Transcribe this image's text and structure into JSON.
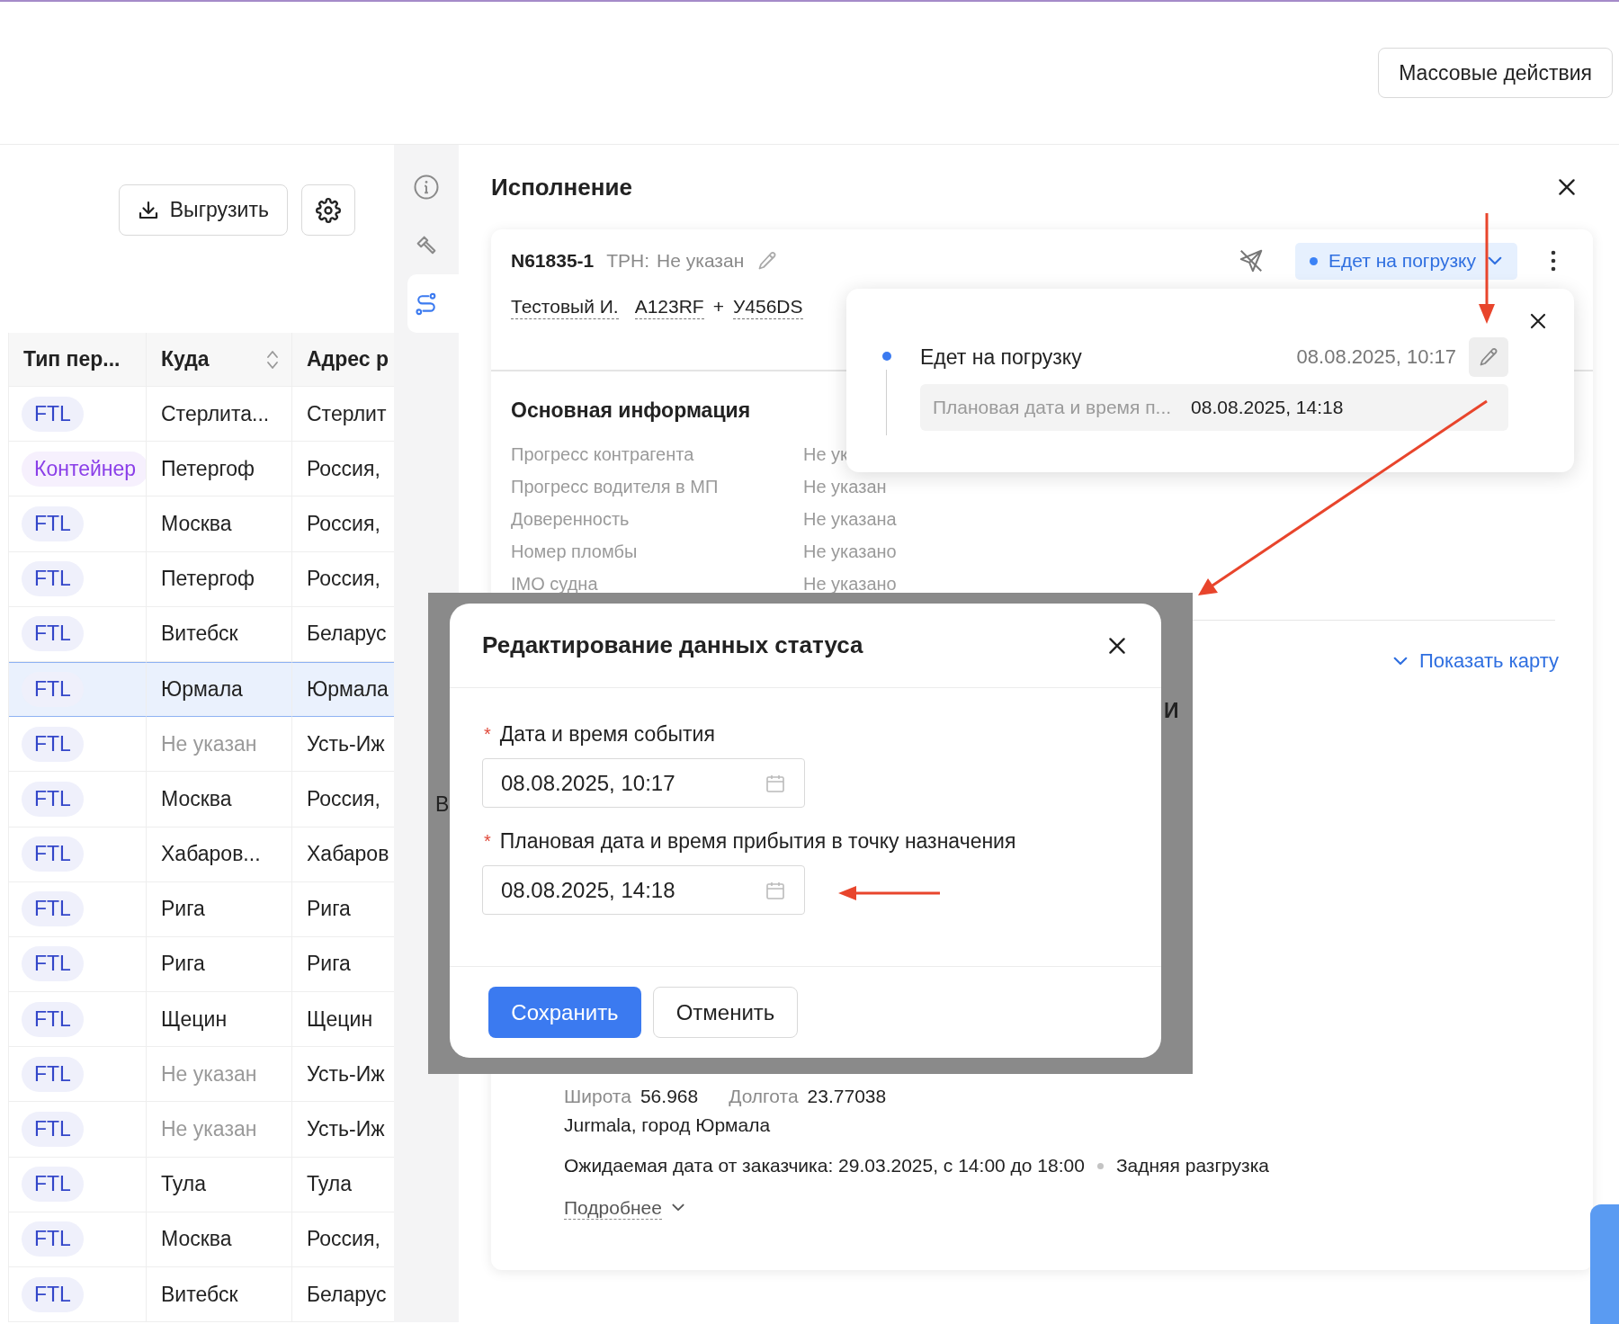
{
  "header": {
    "bulk_button": "Массовые действия"
  },
  "toolbar": {
    "export_button": "Выгрузить"
  },
  "table": {
    "columns": [
      {
        "label": "Тип пер...",
        "sortable": false
      },
      {
        "label": "Куда",
        "sortable": true
      },
      {
        "label": "Адрес р",
        "sortable": false
      }
    ],
    "rows": [
      {
        "type": "FTL",
        "color": "#3346c9",
        "to": "Стерлита...",
        "to_missing": false,
        "address": "Стерлит",
        "selected": false
      },
      {
        "type": "Контейнер",
        "color": "#8a3ee8",
        "to": "Петергоф",
        "to_missing": false,
        "address": "Россия,",
        "selected": false
      },
      {
        "type": "FTL",
        "color": "#3346c9",
        "to": "Москва",
        "to_missing": false,
        "address": "Россия,",
        "selected": false
      },
      {
        "type": "FTL",
        "color": "#3346c9",
        "to": "Петергоф",
        "to_missing": false,
        "address": "Россия,",
        "selected": false
      },
      {
        "type": "FTL",
        "color": "#3346c9",
        "to": "Витебск",
        "to_missing": false,
        "address": "Беларус",
        "selected": false
      },
      {
        "type": "FTL",
        "color": "#3346c9",
        "to": "Юрмала",
        "to_missing": false,
        "address": "Юрмала",
        "selected": true
      },
      {
        "type": "FTL",
        "color": "#3346c9",
        "to": "Не указан",
        "to_missing": true,
        "address": "Усть-Иж",
        "selected": false
      },
      {
        "type": "FTL",
        "color": "#3346c9",
        "to": "Москва",
        "to_missing": false,
        "address": "Россия,",
        "selected": false
      },
      {
        "type": "FTL",
        "color": "#3346c9",
        "to": "Хабаров...",
        "to_missing": false,
        "address": "Хабаров",
        "selected": false
      },
      {
        "type": "FTL",
        "color": "#3346c9",
        "to": "Рига",
        "to_missing": false,
        "address": "Рига",
        "selected": false
      },
      {
        "type": "FTL",
        "color": "#3346c9",
        "to": "Рига",
        "to_missing": false,
        "address": "Рига",
        "selected": false
      },
      {
        "type": "FTL",
        "color": "#3346c9",
        "to": "Щецин",
        "to_missing": false,
        "address": "Щецин",
        "selected": false
      },
      {
        "type": "FTL",
        "color": "#3346c9",
        "to": "Не указан",
        "to_missing": true,
        "address": "Усть-Иж",
        "selected": false
      },
      {
        "type": "FTL",
        "color": "#3346c9",
        "to": "Не указан",
        "to_missing": true,
        "address": "Усть-Иж",
        "selected": false
      },
      {
        "type": "FTL",
        "color": "#3346c9",
        "to": "Тула",
        "to_missing": false,
        "address": "Тула",
        "selected": false
      },
      {
        "type": "FTL",
        "color": "#3346c9",
        "to": "Москва",
        "to_missing": false,
        "address": "Россия,",
        "selected": false
      },
      {
        "type": "FTL",
        "color": "#3346c9",
        "to": "Витебск",
        "to_missing": false,
        "address": "Беларус",
        "selected": false
      }
    ]
  },
  "side_tabs": [
    {
      "kind": "info",
      "selected": false
    },
    {
      "kind": "tools",
      "selected": false
    },
    {
      "kind": "route",
      "selected": true
    }
  ],
  "panel": {
    "title": "Исполнение",
    "order": {
      "number": "N61835-1",
      "trn_label": "ТРН:",
      "trn_value": "Не указан",
      "driver": "Тестовый И.",
      "truck": "A123RF",
      "plus": "+",
      "trailer": "У456DS",
      "status": {
        "label": "Едет на погрузку",
        "color": "#3b82f6"
      }
    },
    "main_info": {
      "title": "Основная информация",
      "rows": [
        {
          "label": "Прогресс контрагента",
          "value": "Не ук"
        },
        {
          "label": "Прогресс водителя в МП",
          "value": "Не указан"
        },
        {
          "label": "Доверенность",
          "value": "Не указана"
        },
        {
          "label": "Номер пломбы",
          "value": "Не указано"
        },
        {
          "label": "IMO судна",
          "value": "Не указано"
        }
      ]
    },
    "show_map": "Показать карту",
    "point": {
      "lat_label": "Широта",
      "lat": "56.968",
      "lon_label": "Долгота",
      "lon": "23.77038",
      "address": "Jurmala, город Юрмала",
      "expected": "Ожидаемая дата от заказчика: 29.03.2025, с 14:00 до 18:00",
      "unloading": "Задняя разгрузка",
      "more": "Подробнее"
    }
  },
  "popover": {
    "status": "Едет на погрузку",
    "time": "08.08.2025, 10:17",
    "planned_label": "Плановая дата и время п...",
    "planned_value": "08.08.2025, 14:18"
  },
  "modal": {
    "title": "Редактирование данных статуса",
    "fields": [
      {
        "mark": "*",
        "label": "Дата и время события",
        "value": "08.08.2025, 10:17"
      },
      {
        "mark": "*",
        "label": "Плановая дата и время прибытия в точку назначения",
        "value": "08.08.2025, 14:18"
      }
    ],
    "save": "Сохранить",
    "cancel": "Отменить"
  },
  "backdrop_fragments": [
    "В",
    "И"
  ]
}
